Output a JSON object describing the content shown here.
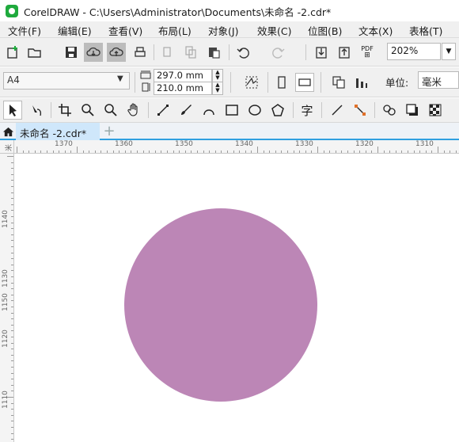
{
  "app": {
    "title": "CorelDRAW - C:\\Users\\Administrator\\Documents\\未命名 -2.cdr*"
  },
  "menu": [
    {
      "label": "文件(F)"
    },
    {
      "label": "编辑(E)"
    },
    {
      "label": "查看(V)"
    },
    {
      "label": "布局(L)"
    },
    {
      "label": "对象(J)"
    },
    {
      "label": "效果(C)"
    },
    {
      "label": "位图(B)"
    },
    {
      "label": "文本(X)"
    },
    {
      "label": "表格(T)"
    }
  ],
  "toolbar": {
    "zoom_value": "202%",
    "pdf_label": "PDF"
  },
  "property_bar": {
    "page_size": "A4",
    "width": "297.0 mm",
    "height": "210.0 mm",
    "unit_label": "单位:",
    "unit_value": "毫米"
  },
  "tools": {
    "text_tool_glyph": "字"
  },
  "tabs": {
    "document": "未命名 -2.cdr*",
    "add": "+"
  },
  "rulers": {
    "top": [
      "1370",
      "1360",
      "1350",
      "1340",
      "1330",
      "1320",
      "1310"
    ],
    "left": [
      "1150",
      "1140",
      "1130",
      "1120",
      "1110"
    ],
    "unit_mark": "米"
  },
  "canvas": {
    "circle_color": "#bc86b6",
    "accent": "#2fa0e0"
  }
}
